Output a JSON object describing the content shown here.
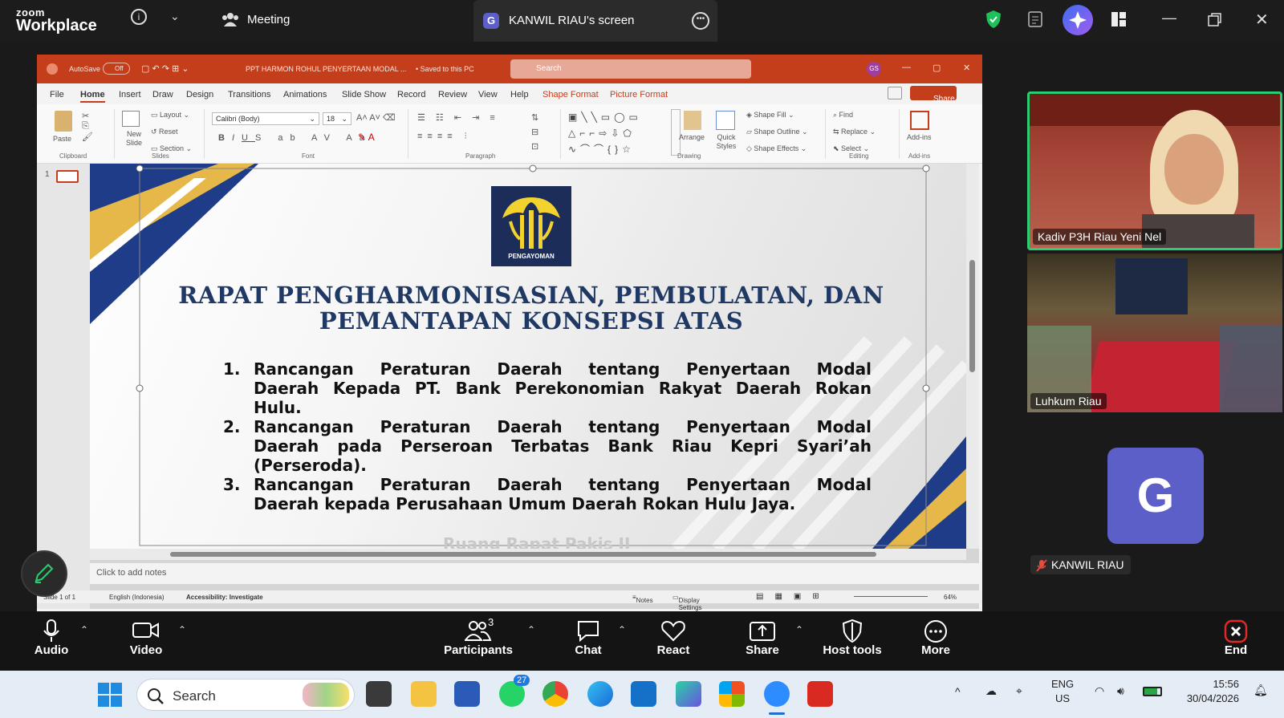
{
  "zoom": {
    "brand_top": "zoom",
    "brand_bottom": "Workplace",
    "meeting_label": "Meeting",
    "share_avatar": "G",
    "share_title": "KANWIL RIAU's screen"
  },
  "ppt": {
    "autosave": "AutoSave",
    "autosave_state": "Off",
    "doc_title": "PPT HARMON ROHUL PENYERTAAN MODAL ...",
    "saved": "• Saved to this PC",
    "search_placeholder": "Search",
    "user_initials": "GS",
    "tabs": [
      "File",
      "Home",
      "Insert",
      "Draw",
      "Design",
      "Transitions",
      "Animations",
      "Slide Show",
      "Record",
      "Review",
      "View",
      "Help",
      "Shape Format",
      "Picture Format"
    ],
    "share": "Share",
    "ribbon": {
      "paste": "Paste",
      "new_slide": "New Slide",
      "layout": "Layout",
      "reset": "Reset",
      "section": "Section",
      "font_name": "Calibri (Body)",
      "font_size": "18",
      "arrange": "Arrange",
      "quick_styles": "Quick Styles",
      "shape_fill": "Shape Fill",
      "shape_outline": "Shape Outline",
      "shape_effects": "Shape Effects",
      "find": "Find",
      "replace": "Replace",
      "select": "Select",
      "addins": "Add-ins",
      "groups": [
        "Clipboard",
        "Slides",
        "Font",
        "Paragraph",
        "Drawing",
        "Editing",
        "Add-ins"
      ]
    },
    "slide_number": "1",
    "slide": {
      "logo_text": "PENGAYOMAN",
      "title_line1": "RAPAT PENGHARMONISASIAN, PEMBULATAN, DAN",
      "title_line2": "PEMANTAPAN KONSEPSI ATAS",
      "items": [
        {
          "num": "1.",
          "lines": [
            "Rancangan Peraturan Daerah tentang Penyertaan Modal",
            "Daerah Kepada PT. Bank Perekonomian Rakyat Daerah Rokan"
          ],
          "last": "Hulu."
        },
        {
          "num": "2.",
          "lines": [
            "Rancangan Peraturan Daerah tentang Penyertaan Modal",
            "Daerah pada Perseroan Terbatas Bank Riau Kepri Syari’ah"
          ],
          "last": "(Perseroda)."
        },
        {
          "num": "3.",
          "lines": [
            "Rancangan Peraturan Daerah tentang Penyertaan Modal"
          ],
          "last": "Daerah kepada Perusahaan Umum Daerah Rokan Hulu Jaya."
        }
      ],
      "footer_faded": "Ruang Rapat Pakis II"
    },
    "notes_placeholder": "Click to add notes",
    "status": {
      "slide_of": "Slide 1 of 1",
      "language": "English (Indonesia)",
      "accessibility": "Accessibility: Investigate",
      "notes": "Notes",
      "display_settings": "Display Settings",
      "zoom": "64%"
    }
  },
  "participants": {
    "video1_name": "Kadiv P3H Riau Yeni Nel",
    "video2_name": "Luhkum Riau",
    "avatar_letter": "G",
    "avatar_name": "KANWIL RIAU"
  },
  "toolbar": {
    "audio": "Audio",
    "video": "Video",
    "participants": "Participants",
    "participants_count": "3",
    "chat": "Chat",
    "react": "React",
    "share": "Share",
    "host_tools": "Host tools",
    "more": "More",
    "end": "End"
  },
  "taskbar": {
    "search": "Search",
    "whatsapp_badge": "27",
    "lang_top": "ENG",
    "lang_bottom": "US",
    "time": "15:56",
    "date": "30/04/2026"
  },
  "colors": {
    "ppt_accent": "#c43e1c",
    "zoom_blue": "#5b5fc7",
    "active_speaker": "#2ecc71",
    "slide_title": "#1f3864"
  }
}
